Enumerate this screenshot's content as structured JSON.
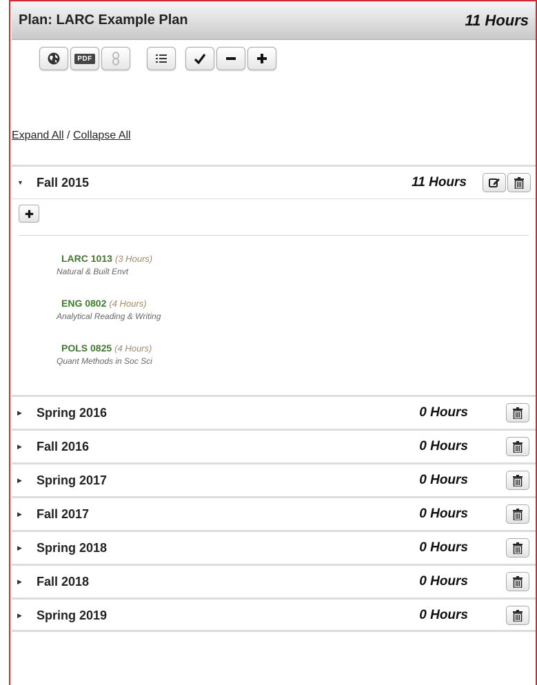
{
  "plan": {
    "title": "Plan: LARC Example Plan",
    "total_hours": "11 Hours"
  },
  "toolbar": {
    "pdf_label": "PDF",
    "icons": [
      "globe-icon",
      "pdf-icon",
      "link-icon",
      "list-icon",
      "check-icon",
      "minus-icon",
      "plus-icon"
    ]
  },
  "links": {
    "expand_all": "Expand All",
    "separator": " / ",
    "collapse_all": "Collapse All"
  },
  "terms": [
    {
      "name": "Fall 2015",
      "hours": "11 Hours",
      "expanded": true,
      "courses": [
        {
          "code": "LARC 1013",
          "hours": "(3 Hours)",
          "name": "Natural & Built Envt"
        },
        {
          "code": "ENG 0802",
          "hours": "(4 Hours)",
          "name": "Analytical Reading & Writing"
        },
        {
          "code": "POLS 0825",
          "hours": "(4 Hours)",
          "name": "Quant Methods in Soc Sci"
        }
      ]
    },
    {
      "name": "Spring 2016",
      "hours": "0 Hours",
      "expanded": false
    },
    {
      "name": "Fall 2016",
      "hours": "0 Hours",
      "expanded": false
    },
    {
      "name": "Spring 2017",
      "hours": "0 Hours",
      "expanded": false
    },
    {
      "name": "Fall 2017",
      "hours": "0 Hours",
      "expanded": false
    },
    {
      "name": "Spring 2018",
      "hours": "0 Hours",
      "expanded": false
    },
    {
      "name": "Fall 2018",
      "hours": "0 Hours",
      "expanded": false
    },
    {
      "name": "Spring 2019",
      "hours": "0 Hours",
      "expanded": false
    }
  ],
  "colors": {
    "border_accent": "#d9232d",
    "course_code": "#3d7a2b",
    "course_hours": "#a08a62"
  }
}
